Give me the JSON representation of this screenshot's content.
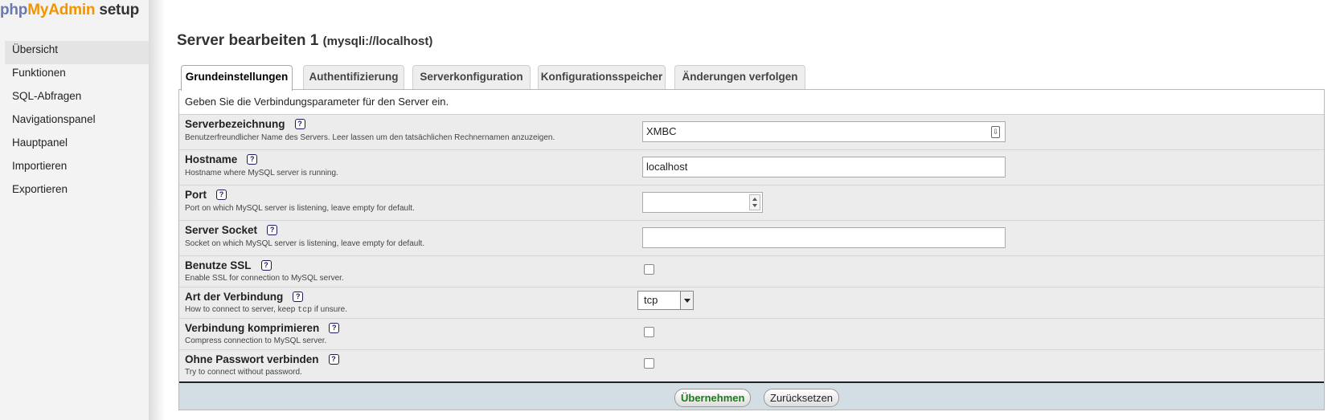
{
  "logo": {
    "php": "php",
    "my": "My",
    "admin": "Admin",
    "setup": "setup"
  },
  "sidebar": {
    "items": [
      {
        "label": "Übersicht",
        "active": true
      },
      {
        "label": "Funktionen"
      },
      {
        "label": "SQL-Abfragen"
      },
      {
        "label": "Navigationspanel"
      },
      {
        "label": "Hauptpanel"
      },
      {
        "label": "Importieren"
      },
      {
        "label": "Exportieren"
      }
    ]
  },
  "page": {
    "title": "Server bearbeiten 1",
    "subtitle": "(mysqli://localhost)"
  },
  "tabs": [
    {
      "label": "Grundeinstellungen",
      "active": true
    },
    {
      "label": "Authentifizierung"
    },
    {
      "label": "Serverkonfiguration"
    },
    {
      "label": "Konfigurationsspeicher"
    },
    {
      "label": "Änderungen verfolgen"
    }
  ],
  "form": {
    "description": "Geben Sie die Verbindungsparameter für den Server ein.",
    "help_glyph": "?",
    "fields": {
      "verbose": {
        "label": "Serverbezeichnung",
        "desc": "Benutzerfreundlicher Name des Servers. Leer lassen um den tatsächlichen Rechnernamen anzuzeigen.",
        "value": "XMBC"
      },
      "host": {
        "label": "Hostname",
        "desc": "Hostname where MySQL server is running.",
        "value": "localhost"
      },
      "port": {
        "label": "Port",
        "desc": "Port on which MySQL server is listening, leave empty for default.",
        "value": ""
      },
      "socket": {
        "label": "Server Socket",
        "desc": "Socket on which MySQL server is listening, leave empty for default.",
        "value": ""
      },
      "ssl": {
        "label": "Benutze SSL",
        "desc": "Enable SSL for connection to MySQL server.",
        "checked": false
      },
      "connect_type": {
        "label": "Art der Verbindung",
        "desc_before": "How to connect to server, keep ",
        "desc_code": "tcp",
        "desc_after": " if unsure.",
        "value": "tcp"
      },
      "compress": {
        "label": "Verbindung komprimieren",
        "desc": "Compress connection to MySQL server.",
        "checked": false
      },
      "nopassword": {
        "label": "Ohne Passwort verbinden",
        "desc": "Try to connect without password.",
        "checked": false
      }
    }
  },
  "buttons": {
    "apply": "Übernehmen",
    "reset": "Zurücksetzen"
  }
}
